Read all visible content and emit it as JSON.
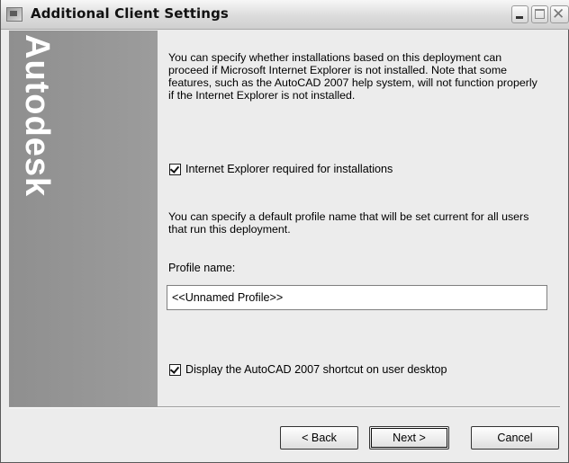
{
  "window": {
    "title": "Additional Client Settings",
    "icons": {
      "app": "app-window-icon",
      "minimize": "minimize-icon",
      "maximize": "maximize-icon",
      "close": "close-icon"
    }
  },
  "sidebar": {
    "brand": "Autodesk"
  },
  "content": {
    "paragraph_ie": "You can specify whether installations based on this deployment can proceed if Microsoft Internet Explorer is not installed. Note that some features, such as the AutoCAD 2007 help system, will not function properly if the Internet Explorer is not installed.",
    "checkbox_ie": {
      "label": "Internet Explorer required for installations",
      "checked": true
    },
    "paragraph_profile": "You can specify a default profile name that will be set current for all users that run this deployment.",
    "profile_label": "Profile name:",
    "profile_value": "<<Unnamed Profile>>",
    "checkbox_shortcut": {
      "label": "Display the AutoCAD 2007 shortcut on user desktop",
      "checked": true
    }
  },
  "buttons": {
    "back": "< Back",
    "next": "Next >",
    "cancel": "Cancel"
  },
  "colors": {
    "sidebar": "#949494",
    "background": "#ececec"
  }
}
